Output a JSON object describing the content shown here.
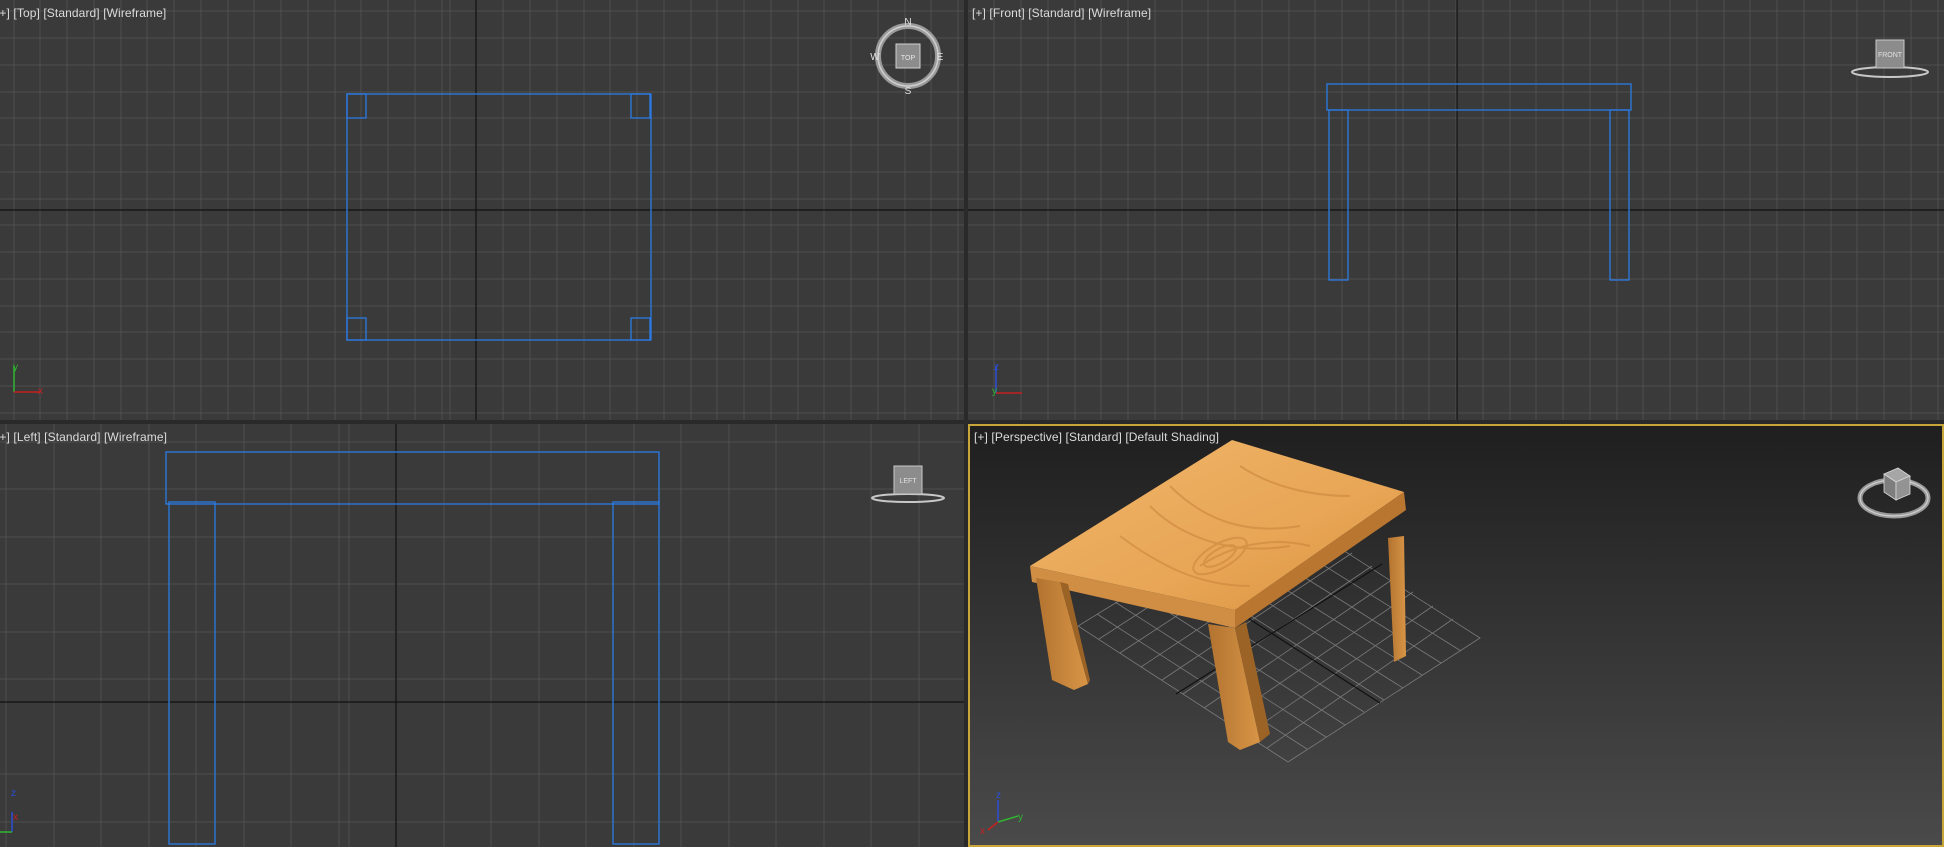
{
  "viewports": {
    "top": {
      "label": {
        "plus": "[+]",
        "view": "[Top]",
        "mode": "[Standard]",
        "shading": "[Wireframe]"
      },
      "compass": {
        "n": "N",
        "s": "S",
        "e": "E",
        "w": "W",
        "cube": "TOP"
      },
      "axes": {
        "a": "y",
        "b": "x"
      }
    },
    "front": {
      "label": {
        "plus": "[+]",
        "view": "[Front]",
        "mode": "[Standard]",
        "shading": "[Wireframe]"
      },
      "cube": "FRONT",
      "axes": {
        "a": "z",
        "b": "y",
        "c": "x"
      }
    },
    "left": {
      "label": {
        "plus": "[+]",
        "view": "[Left]",
        "mode": "[Standard]",
        "shading": "[Wireframe]"
      },
      "cube": "LEFT",
      "axes": {
        "a": "z",
        "b": "x"
      }
    },
    "perspective": {
      "label": {
        "plus": "[+]",
        "view": "[Perspective]",
        "mode": "[Standard]",
        "shading": "[Default Shading]"
      },
      "axes": {
        "a": "z",
        "b": "y",
        "c": "x"
      }
    }
  },
  "colors": {
    "background": "#3a3a3a",
    "grid_minor": "#4d4d4d",
    "grid_major": "#0a0a0a",
    "wireframe": "#2c7be5",
    "active_border": "#c8a63a",
    "wood_light": "#e8a85a",
    "wood_dark": "#c47f34"
  }
}
